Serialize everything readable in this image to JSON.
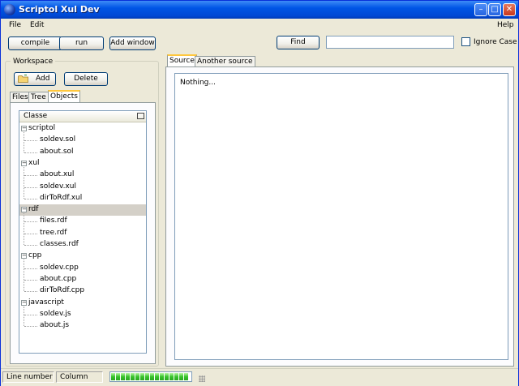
{
  "window": {
    "title": "Scriptol Xul Dev"
  },
  "menu": {
    "file": "File",
    "edit": "Edit",
    "help": "Help"
  },
  "toolbar": {
    "compile": "compile",
    "run": "run",
    "add_window": "Add window",
    "find": "Find",
    "search_value": "",
    "ignore_case": "Ignore Case",
    "ignore_case_checked": false
  },
  "workspace": {
    "legend": "Workspace",
    "add": "Add",
    "delete": "Delete"
  },
  "left_tabs": {
    "files": "Files",
    "tree": "Tree",
    "objects": "Objects",
    "selected": "Objects"
  },
  "tree": {
    "header": "Classe",
    "groups": [
      {
        "label": "scriptol",
        "children": [
          "soldev.sol",
          "about.sol"
        ]
      },
      {
        "label": "xul",
        "children": [
          "about.xul",
          "soldev.xul",
          "dirToRdf.xul"
        ]
      },
      {
        "label": "rdf",
        "children": [
          "files.rdf",
          "tree.rdf",
          "classes.rdf"
        ]
      },
      {
        "label": "cpp",
        "children": [
          "soldev.cpp",
          "about.cpp",
          "dirToRdf.cpp"
        ]
      },
      {
        "label": "javascript",
        "children": [
          "soldev.js",
          "about.js"
        ]
      }
    ],
    "selected": "rdf"
  },
  "right_tabs": {
    "source": "Source",
    "another": "Another source",
    "selected": "Source"
  },
  "editor": {
    "text": "Nothing..."
  },
  "status": {
    "line": "Line number",
    "column": "Column",
    "progress": 1.0
  }
}
